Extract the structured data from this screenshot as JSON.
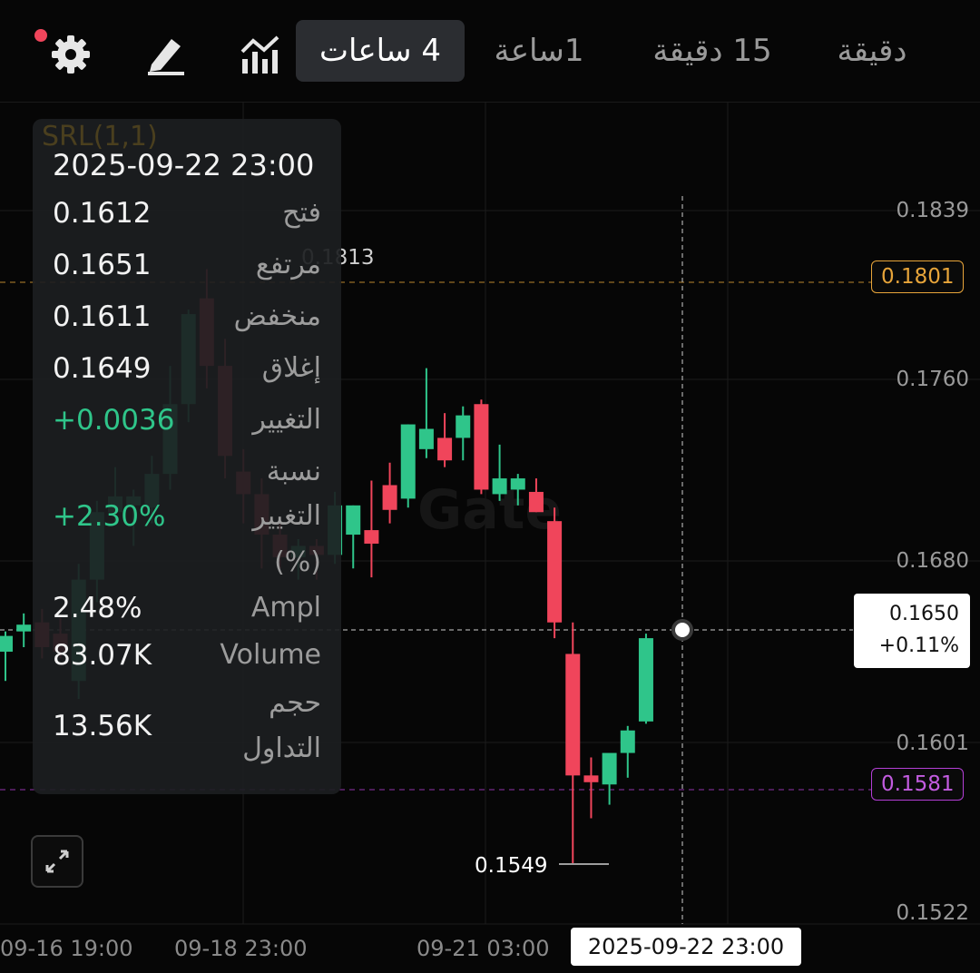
{
  "toolbar": {
    "timeframes": [
      "4 ساعات",
      "1ساعة",
      "15 دقيقة",
      "دقيقة"
    ],
    "active_timeframe": "4 ساعات",
    "icons": [
      "settings-icon",
      "drawing-pen-icon",
      "indicators-icon"
    ],
    "notification_color": "#f0455b"
  },
  "indicator": {
    "label": "SRL(1,1)"
  },
  "watermark": "Gate",
  "info_panel": {
    "datetime": "2025-09-22 23:00",
    "open_label": "فتح",
    "open": "0.1612",
    "high_label": "مرتفع",
    "high": "0.1651",
    "low_label": "منخفض",
    "low": "0.1611",
    "close_label": "إغلاق",
    "close": "0.1649",
    "change_label": "التغيير",
    "change": "+0.0036",
    "change_pct_label_1": "نسبة",
    "change_pct_label_2": "التغيير",
    "change_pct_label_3": "(%)",
    "change_pct": "+2.30%",
    "ampl_label": "Ampl",
    "ampl": "2.48%",
    "volume_label": "Volume",
    "volume": "83.07K",
    "turnover_label_1": "حجم",
    "turnover_label_2": "التداول",
    "turnover": "13.56K"
  },
  "price_axis": [
    "0.1839",
    "0.1760",
    "0.1680",
    "0.1601",
    "0.1522"
  ],
  "markers": {
    "high_marker": "0.1813",
    "low_marker": "0.1549",
    "upper_line": "0.1801",
    "lower_line": "0.1581",
    "current_price": "0.1650",
    "current_change": "+0.11%"
  },
  "time_axis": [
    "09-16 19:00",
    "09-18 23:00",
    "09-21 03:00"
  ],
  "selected_time": "2025-09-22 23:00",
  "colors": {
    "up": "#2fc58a",
    "down": "#f0455b",
    "upper_line": "#e8a53a",
    "lower_line": "#b43fd6"
  },
  "chart_data": {
    "type": "candlestick",
    "ylim": [
      0.1522,
      0.1839
    ],
    "candles": [
      {
        "o": 0.1643,
        "h": 0.1652,
        "l": 0.163,
        "c": 0.165
      },
      {
        "o": 0.1652,
        "h": 0.166,
        "l": 0.1645,
        "c": 0.1655
      },
      {
        "o": 0.1656,
        "h": 0.1662,
        "l": 0.164,
        "c": 0.1645
      },
      {
        "o": 0.1651,
        "h": 0.1658,
        "l": 0.164,
        "c": 0.1643
      },
      {
        "o": 0.163,
        "h": 0.1682,
        "l": 0.1622,
        "c": 0.1675
      },
      {
        "o": 0.1675,
        "h": 0.171,
        "l": 0.1665,
        "c": 0.1705
      },
      {
        "o": 0.1705,
        "h": 0.1725,
        "l": 0.17,
        "c": 0.1712
      },
      {
        "o": 0.1708,
        "h": 0.1715,
        "l": 0.169,
        "c": 0.1712
      },
      {
        "o": 0.1707,
        "h": 0.173,
        "l": 0.17,
        "c": 0.1722
      },
      {
        "o": 0.1722,
        "h": 0.177,
        "l": 0.1715,
        "c": 0.1753
      },
      {
        "o": 0.1753,
        "h": 0.1795,
        "l": 0.1745,
        "c": 0.1793
      },
      {
        "o": 0.18,
        "h": 0.1813,
        "l": 0.176,
        "c": 0.177
      },
      {
        "o": 0.177,
        "h": 0.1782,
        "l": 0.172,
        "c": 0.173
      },
      {
        "o": 0.1723,
        "h": 0.1733,
        "l": 0.17,
        "c": 0.1713
      },
      {
        "o": 0.1713,
        "h": 0.172,
        "l": 0.168,
        "c": 0.1695
      },
      {
        "o": 0.1695,
        "h": 0.1703,
        "l": 0.168,
        "c": 0.1685
      },
      {
        "o": 0.1685,
        "h": 0.1693,
        "l": 0.1675,
        "c": 0.169
      },
      {
        "o": 0.169,
        "h": 0.1693,
        "l": 0.1675,
        "c": 0.1686
      },
      {
        "o": 0.1686,
        "h": 0.1714,
        "l": 0.1682,
        "c": 0.1708
      },
      {
        "o": 0.1695,
        "h": 0.1708,
        "l": 0.168,
        "c": 0.1708
      },
      {
        "o": 0.1697,
        "h": 0.1719,
        "l": 0.1676,
        "c": 0.1691
      },
      {
        "o": 0.1717,
        "h": 0.1727,
        "l": 0.17,
        "c": 0.1706
      },
      {
        "o": 0.1711,
        "h": 0.1744,
        "l": 0.1707,
        "c": 0.1744
      },
      {
        "o": 0.1733,
        "h": 0.1769,
        "l": 0.1729,
        "c": 0.1742
      },
      {
        "o": 0.1738,
        "h": 0.1749,
        "l": 0.1725,
        "c": 0.1728
      },
      {
        "o": 0.1738,
        "h": 0.1752,
        "l": 0.1728,
        "c": 0.1748
      },
      {
        "o": 0.1753,
        "h": 0.1755,
        "l": 0.1713,
        "c": 0.1715
      },
      {
        "o": 0.1713,
        "h": 0.1735,
        "l": 0.171,
        "c": 0.172
      },
      {
        "o": 0.1715,
        "h": 0.1722,
        "l": 0.1708,
        "c": 0.172
      },
      {
        "o": 0.1714,
        "h": 0.172,
        "l": 0.1705,
        "c": 0.1705
      },
      {
        "o": 0.1701,
        "h": 0.1707,
        "l": 0.1649,
        "c": 0.1656
      },
      {
        "o": 0.1642,
        "h": 0.1656,
        "l": 0.1549,
        "c": 0.1588
      },
      {
        "o": 0.1588,
        "h": 0.1596,
        "l": 0.1569,
        "c": 0.1585
      },
      {
        "o": 0.1584,
        "h": 0.1597,
        "l": 0.1575,
        "c": 0.1598
      },
      {
        "o": 0.1598,
        "h": 0.161,
        "l": 0.1587,
        "c": 0.1608
      },
      {
        "o": 0.1612,
        "h": 0.1651,
        "l": 0.1611,
        "c": 0.1649
      }
    ]
  }
}
